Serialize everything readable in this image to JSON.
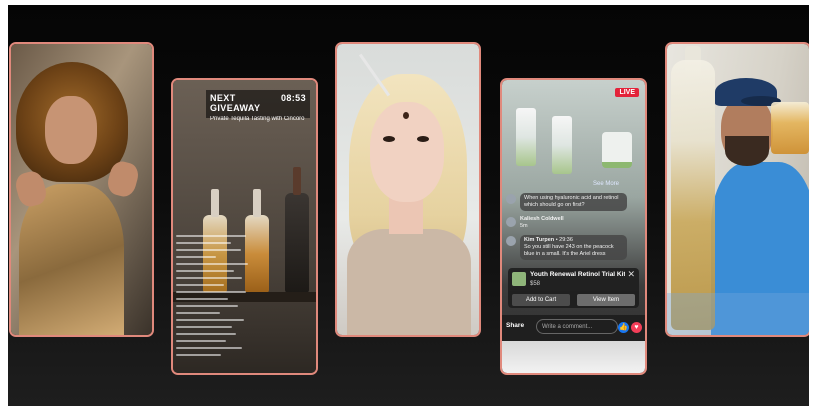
{
  "colors": {
    "frame_border": "#e0897c",
    "stage_bg": "#0b0b0b",
    "live_badge": "#e3233a",
    "like_blue": "#1877f2",
    "heart_red": "#f33e58"
  },
  "cards": {
    "tequila": {
      "banner_title": "NEXT GIVEAWAY",
      "banner_time": "08:53",
      "banner_subtitle": "Private Tequila Tasting with Cincoro Founders"
    },
    "live_shop": {
      "live_label": "LIVE",
      "see_more": "See More",
      "comments": [
        {
          "name": "",
          "time": "",
          "text": "When using hyaluronic acid and retinol which should go on first?"
        },
        {
          "name": "Kaliesh Coldwell",
          "time": "",
          "text": "5m"
        },
        {
          "name": "Kim Turpen",
          "time": "• 29:36",
          "text": "So you still have 243 on the peacock blue in a small. It's the Ariel dress"
        }
      ],
      "product_title": "Youth Renewal Retinol Trial Kit",
      "product_price": "$58",
      "close_symbol": "✕",
      "add_to_cart": "Add to Cart",
      "view_item": "View Item",
      "share": "Share",
      "comment_placeholder": "Write a comment...",
      "like_symbol": "👍",
      "heart_symbol": "♥"
    }
  }
}
